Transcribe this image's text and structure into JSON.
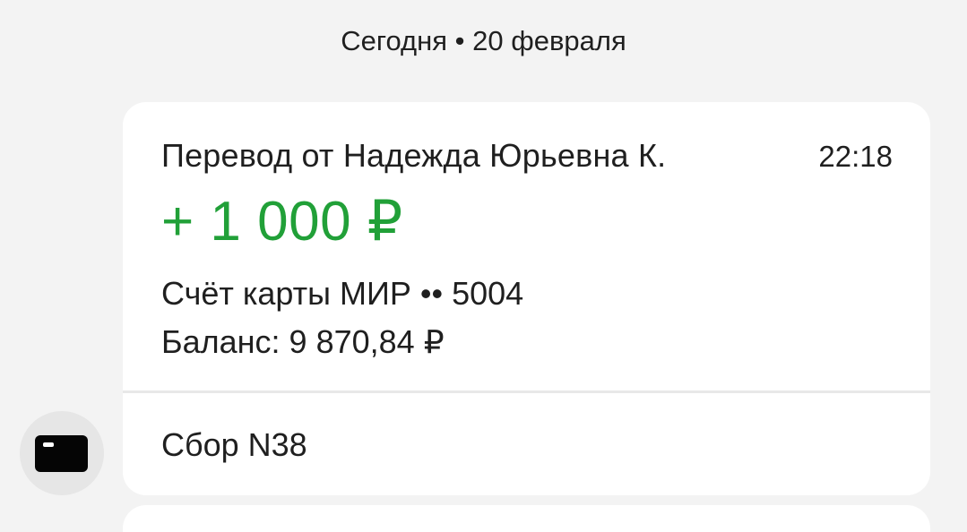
{
  "date_separator": "Сегодня • 20 февраля",
  "message": {
    "sender_title": "Перевод от Надежда Юрьевна К.",
    "time": "22:18",
    "amount": "+ 1 000 ₽",
    "account": "Счёт карты МИР •• 5004",
    "balance": "Баланс: 9 870,84 ₽",
    "collection_label": "Сбор N38"
  },
  "icons": {
    "avatar": "bank-card-icon"
  },
  "colors": {
    "background": "#f3f3f3",
    "card": "#ffffff",
    "amount_green": "#21a038",
    "text": "#1f1f1f"
  }
}
